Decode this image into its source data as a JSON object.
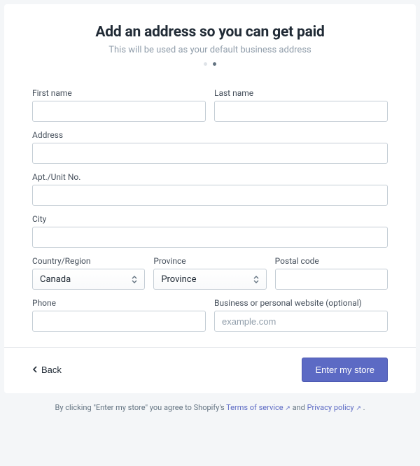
{
  "header": {
    "title": "Add an address so you can get paid",
    "subtitle": "This will be used as your default business address"
  },
  "form": {
    "first_name": {
      "label": "First name",
      "value": ""
    },
    "last_name": {
      "label": "Last name",
      "value": ""
    },
    "address": {
      "label": "Address",
      "value": ""
    },
    "apt": {
      "label": "Apt./Unit No.",
      "value": ""
    },
    "city": {
      "label": "City",
      "value": ""
    },
    "country": {
      "label": "Country/Region",
      "value": "Canada"
    },
    "province": {
      "label": "Province",
      "value": "Province"
    },
    "postal_code": {
      "label": "Postal code",
      "value": ""
    },
    "phone": {
      "label": "Phone",
      "value": ""
    },
    "website": {
      "label": "Business or personal website (optional)",
      "placeholder": "example.com",
      "value": ""
    }
  },
  "actions": {
    "back": "Back",
    "submit": "Enter my store"
  },
  "footer": {
    "prefix": "By clicking \"Enter my store\" you agree to Shopify's ",
    "tos": "Terms of service",
    "and": " and ",
    "privacy": "Privacy policy",
    "period": " ."
  }
}
